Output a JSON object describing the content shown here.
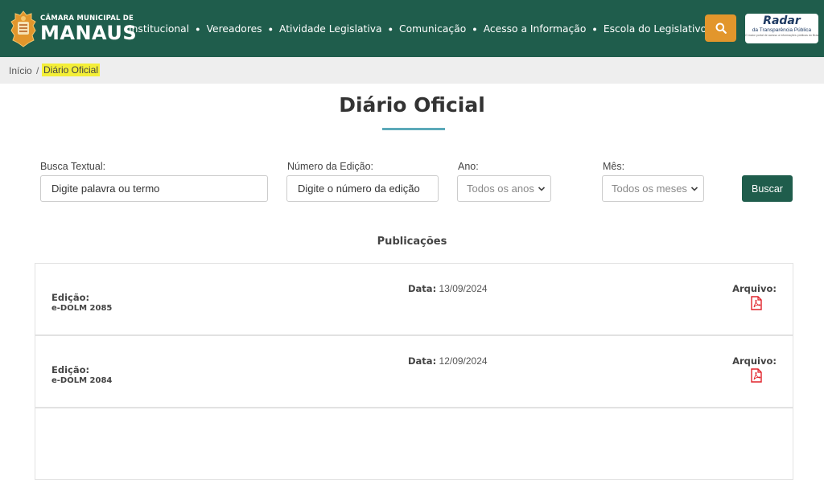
{
  "header": {
    "logo_line1": "CÂMARA MUNICIPAL DE",
    "logo_line2": "MANAUS",
    "nav": [
      "Institucional",
      "Vereadores",
      "Atividade Legislativa",
      "Comunicação",
      "Acesso a Informação",
      "Escola do Legislativo"
    ],
    "search_icon": "search-icon",
    "radar": {
      "title": "Radar",
      "subtitle": "da Transparência Pública",
      "tagline": "O maior portal de acesso a informações públicas do Brasil"
    }
  },
  "breadcrumb": {
    "home": "Início",
    "separator": "/",
    "current": "Diário Oficial"
  },
  "page": {
    "title": "Diário Oficial"
  },
  "filters": {
    "busca_label": "Busca Textual:",
    "busca_placeholder": "Digite palavra ou termo",
    "edicao_label": "Número da Edição:",
    "edicao_placeholder": "Digite o número da edição",
    "ano_label": "Ano:",
    "ano_value": "Todos os anos",
    "mes_label": "Mês:",
    "mes_value": "Todos os meses",
    "buscar_label": "Buscar"
  },
  "publications": {
    "heading": "Publicações",
    "items": [
      {
        "edicao_label": "Edição:",
        "edicao": "e-DOLM 2085",
        "data_label": "Data:",
        "data": "13/09/2024",
        "arquivo_label": "Arquivo:"
      },
      {
        "edicao_label": "Edição:",
        "edicao": "e-DOLM 2084",
        "data_label": "Data:",
        "data": "12/09/2024",
        "arquivo_label": "Arquivo:"
      }
    ]
  },
  "colors": {
    "header_bg": "#1f5d4c",
    "search_btn": "#e2962c",
    "highlight": "#f4ef38",
    "accent_underline": "#5ba9b9",
    "pdf_red": "#e0232b"
  }
}
